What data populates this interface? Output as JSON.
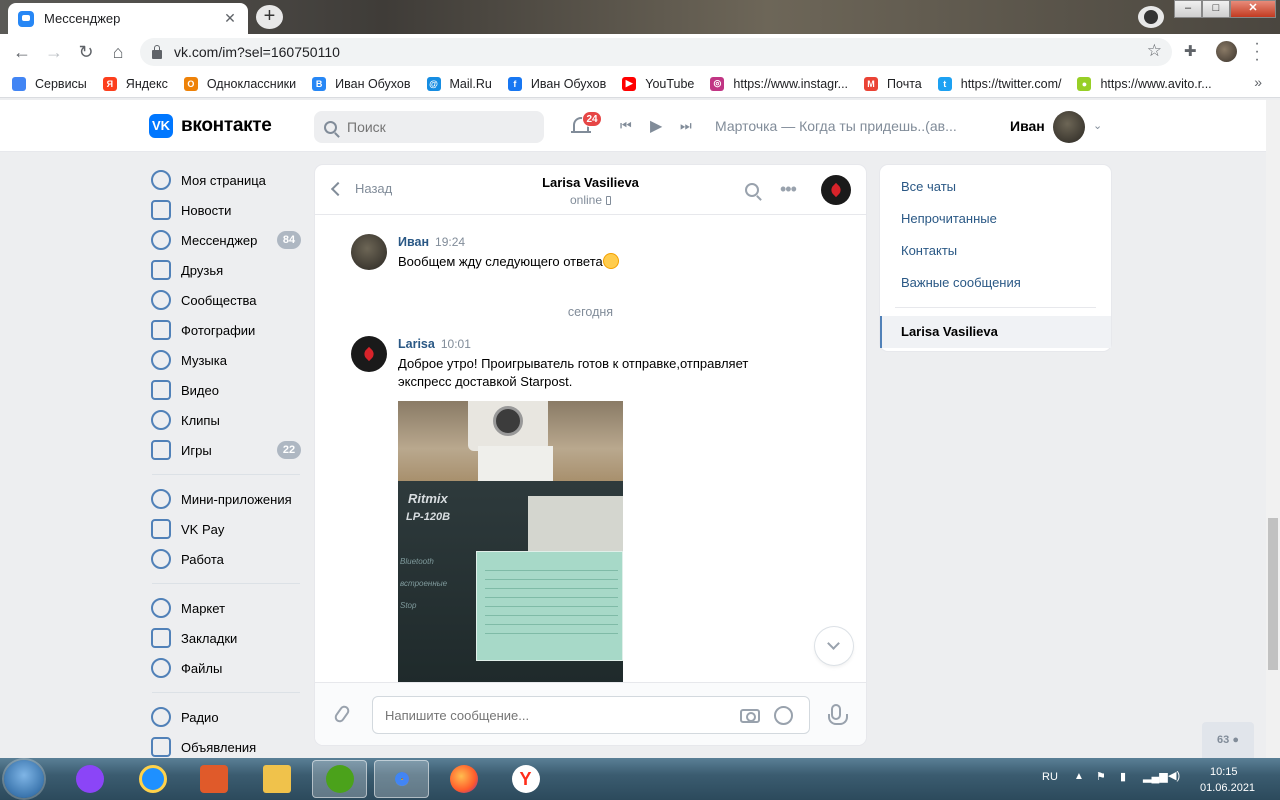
{
  "browser": {
    "tab_title": "Мессенджер",
    "tab_close": "✕",
    "new_tab": "+",
    "url": "vk.com/im?sel=160750110",
    "bookmarks": [
      {
        "label": "Сервисы",
        "color": "#4285f4"
      },
      {
        "label": "Яндекс",
        "color": "#fc3f1d",
        "glyph": "Я"
      },
      {
        "label": "Одноклассники",
        "color": "#ee8208",
        "glyph": "О"
      },
      {
        "label": "Иван Обухов",
        "color": "#2787f5",
        "glyph": "В"
      },
      {
        "label": "Mail.Ru",
        "color": "#168de2",
        "glyph": "@"
      },
      {
        "label": "Иван Обухов",
        "color": "#1877f2",
        "glyph": "f"
      },
      {
        "label": "YouTube",
        "color": "#ff0000",
        "glyph": "▶"
      },
      {
        "label": "https://www.instagr...",
        "color": "#c13584",
        "glyph": "◎"
      },
      {
        "label": "Почта",
        "color": "#ea4335",
        "glyph": "M"
      },
      {
        "label": "https://twitter.com/",
        "color": "#1da1f2",
        "glyph": "t"
      },
      {
        "label": "https://www.avito.r...",
        "color": "#97cf26",
        "glyph": "●"
      }
    ]
  },
  "vk": {
    "logo_text": "вконтакте",
    "logo_glyph": "VK",
    "search_placeholder": "Поиск",
    "notifications_count": "24",
    "track": "Марточка — Когда ты придешь..(ав...",
    "user_name": "Иван"
  },
  "nav": {
    "items": [
      {
        "label": "Моя страница"
      },
      {
        "label": "Новости"
      },
      {
        "label": "Мессенджер",
        "count": "84"
      },
      {
        "label": "Друзья"
      },
      {
        "label": "Сообщества"
      },
      {
        "label": "Фотографии"
      },
      {
        "label": "Музыка"
      },
      {
        "label": "Видео"
      },
      {
        "label": "Клипы"
      },
      {
        "label": "Игры",
        "count": "22"
      }
    ],
    "items2": [
      {
        "label": "Мини-приложения"
      },
      {
        "label": "VK Pay"
      },
      {
        "label": "Работа"
      }
    ],
    "items3": [
      {
        "label": "Маркет"
      },
      {
        "label": "Закладки"
      },
      {
        "label": "Файлы"
      }
    ],
    "items4": [
      {
        "label": "Радио"
      },
      {
        "label": "Объявления"
      }
    ]
  },
  "chat": {
    "back_label": "Назад",
    "title": "Larisa Vasilieva",
    "status": "online",
    "day_separator": "сегодня",
    "composer_placeholder": "Напишите сообщение...",
    "messages": [
      {
        "author": "Иван",
        "time": "19:24",
        "text": "Вообщем жду следующего ответа"
      },
      {
        "author": "Larisa",
        "time": "10:01",
        "text": "Доброе утро! Проигрыватель готов к отправке,отправляет экспресс доставкой Starpost."
      }
    ],
    "photo": {
      "brand": "Ritmix",
      "model": "LP-120B",
      "side_lines": [
        "Bluetooth",
        "встроенные",
        "Stop"
      ]
    }
  },
  "filters": {
    "items": [
      "Все чаты",
      "Непрочитанные",
      "Контакты",
      "Важные сообщения"
    ],
    "active": "Larisa Vasilieva"
  },
  "online_count": "63",
  "taskbar": {
    "lang": "RU",
    "time": "10:15",
    "date": "01.06.2021"
  }
}
